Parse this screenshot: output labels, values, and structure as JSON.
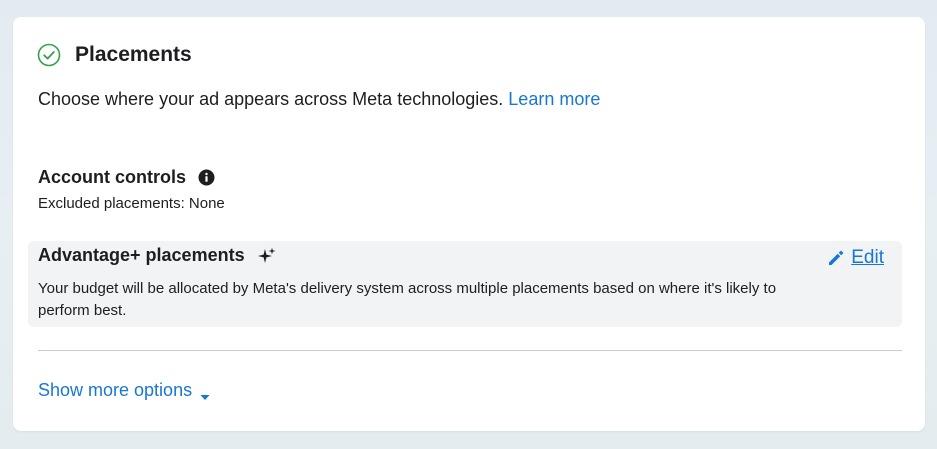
{
  "placements": {
    "title": "Placements",
    "status_icon": "check-circle-icon",
    "description": "Choose where your ad appears across Meta technologies.",
    "learn_more": "Learn more"
  },
  "account_controls": {
    "title": "Account controls",
    "info_icon": "info-icon",
    "excluded": "Excluded placements: None"
  },
  "advantage": {
    "title": "Advantage+ placements",
    "sparkle_icon": "sparkle-icon",
    "edit_label": "Edit",
    "edit_icon": "pencil-icon",
    "description": "Your budget will be allocated by Meta's delivery system across multiple placements based on where it's likely to perform best."
  },
  "show_more": {
    "label": "Show more options",
    "icon": "caret-down-icon"
  },
  "colors": {
    "link": "#1877d2",
    "check": "#31a24c",
    "text": "#1c1e21"
  }
}
